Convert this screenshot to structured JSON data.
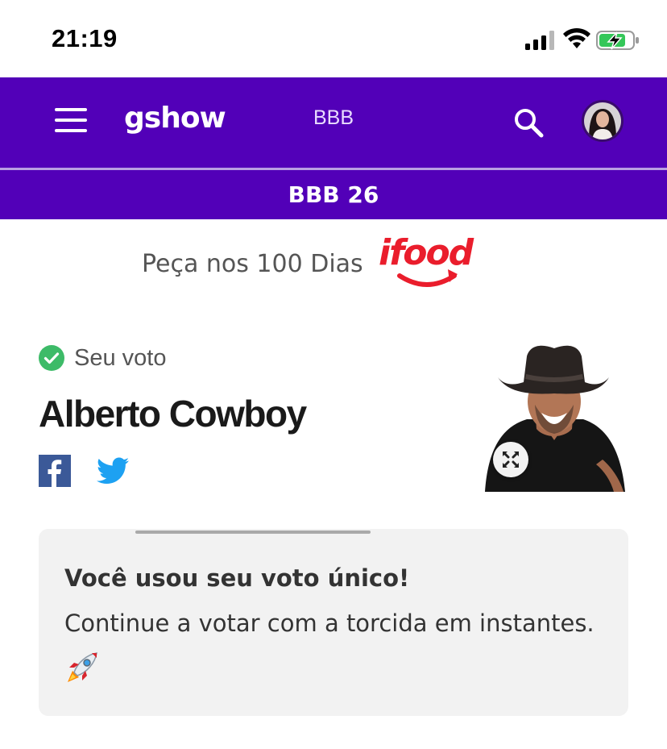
{
  "status_bar": {
    "time": "21:19",
    "icons": [
      "signal-icon",
      "wifi-icon",
      "battery-charging-icon"
    ]
  },
  "header": {
    "logo": "gshow",
    "section": "BBB",
    "icons": [
      "menu-icon",
      "search-icon",
      "avatar"
    ]
  },
  "subheader": {
    "title": "BBB 26"
  },
  "ad": {
    "text": "Peça nos 100 Dias",
    "brand": "ifood"
  },
  "vote": {
    "status_label": "Seu voto",
    "participant_name": "Alberto Cowboy",
    "share_icons": [
      "facebook-icon",
      "twitter-icon"
    ]
  },
  "card": {
    "title": "Você usou seu voto único!",
    "text": "Continue a votar com a torcida em instantes.",
    "emoji": "rocket-icon"
  },
  "colors": {
    "brand_purple": "#5200b8",
    "ifood_red": "#ea1d2c",
    "check_green": "#3dbb68",
    "facebook_blue": "#3b5998",
    "twitter_blue": "#1da1f2",
    "card_bg": "#f2f2f2"
  }
}
